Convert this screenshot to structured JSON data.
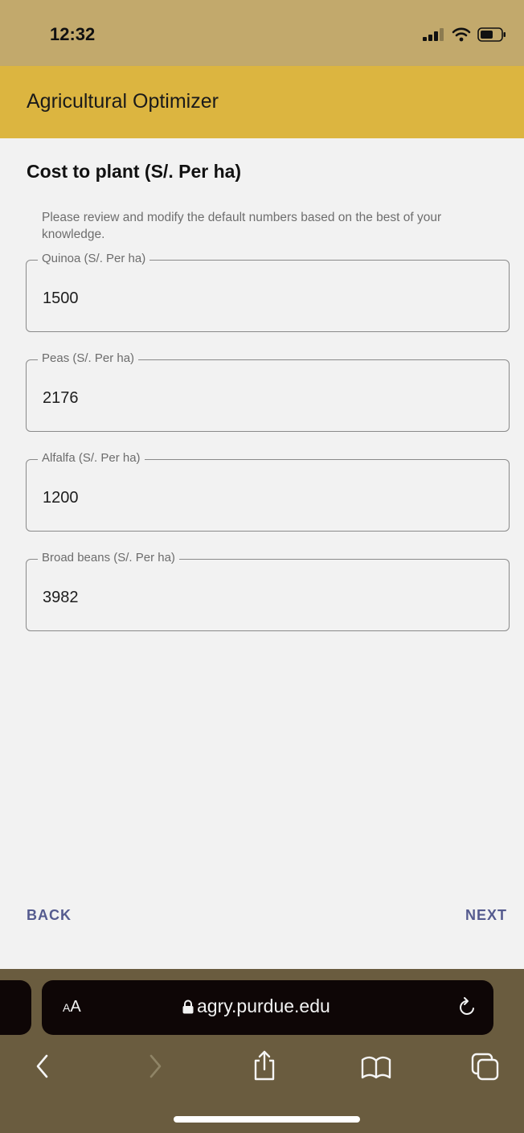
{
  "status": {
    "time": "12:32"
  },
  "app": {
    "title": "Agricultural Optimizer"
  },
  "section": {
    "title": "Cost to plant (S/. Per ha)",
    "helper": "Please review and modify the default numbers based on the best of your knowledge."
  },
  "fields": [
    {
      "label": "Quinoa (S/. Per ha)",
      "value": "1500"
    },
    {
      "label": "Peas (S/. Per ha)",
      "value": "2176"
    },
    {
      "label": "Alfalfa (S/. Per ha)",
      "value": "1200"
    },
    {
      "label": "Broad beans (S/. Per ha)",
      "value": "3982"
    }
  ],
  "nav": {
    "back": "BACK",
    "next": "NEXT"
  },
  "browser": {
    "aa_small": "A",
    "aa_large": "A",
    "url": "agry.purdue.edu",
    "icons": [
      "lock-icon",
      "reload-icon",
      "back-arrow-icon",
      "forward-arrow-icon",
      "share-icon",
      "bookmarks-icon",
      "tabs-icon"
    ]
  },
  "colors": {
    "app_bar": "#dcb540",
    "status_bar": "#c2a96c",
    "accent": "#555b8f",
    "browser_chrome": "#6a5c3f"
  }
}
